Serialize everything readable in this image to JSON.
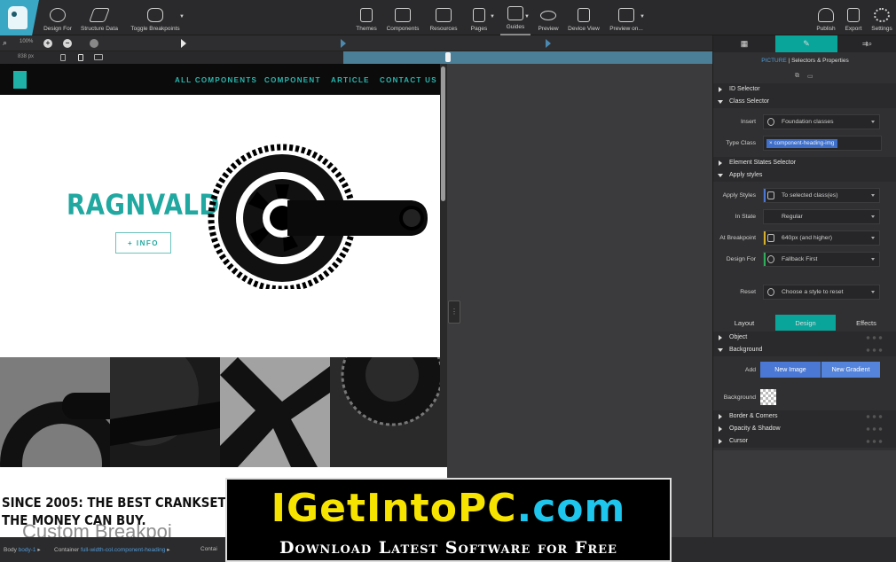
{
  "toolbar": {
    "left_items": [
      {
        "label": "Design For",
        "icon": "globe-icon"
      },
      {
        "label": "Structure Data",
        "icon": "structure-data-icon"
      },
      {
        "label": "Toggle Breakpoints",
        "icon": "breakpoints-icon"
      }
    ],
    "center_items": [
      {
        "label": "Themes",
        "icon": "paint-roller-icon"
      },
      {
        "label": "Components",
        "icon": "components-grid-icon"
      },
      {
        "label": "Resources",
        "icon": "resources-icon"
      },
      {
        "label": "Pages",
        "icon": "pages-icon"
      },
      {
        "label": "Guides",
        "icon": "guides-grid-icon",
        "active": true
      },
      {
        "label": "Preview",
        "icon": "eye-icon"
      },
      {
        "label": "Device View",
        "icon": "device-view-icon"
      },
      {
        "label": "Preview on...",
        "icon": "monitor-icon"
      }
    ],
    "right_items": [
      {
        "label": "Publish",
        "icon": "cloud-upload-icon"
      },
      {
        "label": "Export",
        "icon": "export-file-icon"
      },
      {
        "label": "Settings",
        "icon": "gear-icon"
      }
    ]
  },
  "zoom": {
    "value": "100%"
  },
  "ruler": {
    "width_label": "838 px"
  },
  "page": {
    "nav_links": [
      "ALL COMPONENTS",
      "COMPONENT",
      "ARTICLE",
      "CONTACT US"
    ],
    "hero_title": "RAGNVALD",
    "info_button": "+ INFO",
    "tagline_lines": [
      "SINCE 2005: THE BEST CRANKSET",
      "THE MONEY CAN BUY."
    ],
    "overlay_text": "Custom Breakpoi"
  },
  "statusbar": {
    "crumbs": [
      {
        "label": "Body",
        "class": "body-1"
      },
      {
        "label": "Container",
        "class": "full-width-col.component-heading"
      },
      {
        "label": "Contai",
        "class": ""
      }
    ]
  },
  "panel": {
    "tabs": [
      {
        "icon": "grid-icon"
      },
      {
        "icon": "brush-icon",
        "active": true
      },
      {
        "icon": "selector-search-icon"
      }
    ],
    "subtitle_tag": "PICTURE",
    "subtitle_text": "| Selectors & Properties",
    "sections": {
      "id_selector": "ID Selector",
      "class_selector": "Class Selector",
      "element_states": "Element States Selector",
      "apply_styles": "Apply styles",
      "object": "Object",
      "background": "Background",
      "border": "Border & Corners",
      "opacity": "Opacity & Shadow",
      "cursor": "Cursor"
    },
    "insert_label": "Insert",
    "insert_value": "Foundation classes",
    "type_class_label": "Type Class",
    "type_class_tag": "component-heading-img",
    "apply_styles_label": "Apply Styles",
    "apply_styles_value": "To selected class(es)",
    "in_state_label": "In State",
    "in_state_value": "Regular",
    "at_breakpoint_label": "At Breakpoint",
    "at_breakpoint_value": "640px (and higher)",
    "design_for_label": "Design For",
    "design_for_value": "Fallback First",
    "reset_label": "Reset",
    "reset_value": "Choose a style to reset",
    "subtabs": [
      "Layout",
      "Design",
      "Effects"
    ],
    "add_label": "Add",
    "new_image": "New Image",
    "new_gradient": "New Gradient",
    "background_label": "Background",
    "colors": {
      "accent": "#0aa59a",
      "blue": "#4a78d4"
    }
  },
  "watermark": {
    "main_yellow": "IGetInto",
    "main_yellow2": "PC",
    "main_blue": ".com",
    "sub": "Download Latest Software for Free"
  }
}
